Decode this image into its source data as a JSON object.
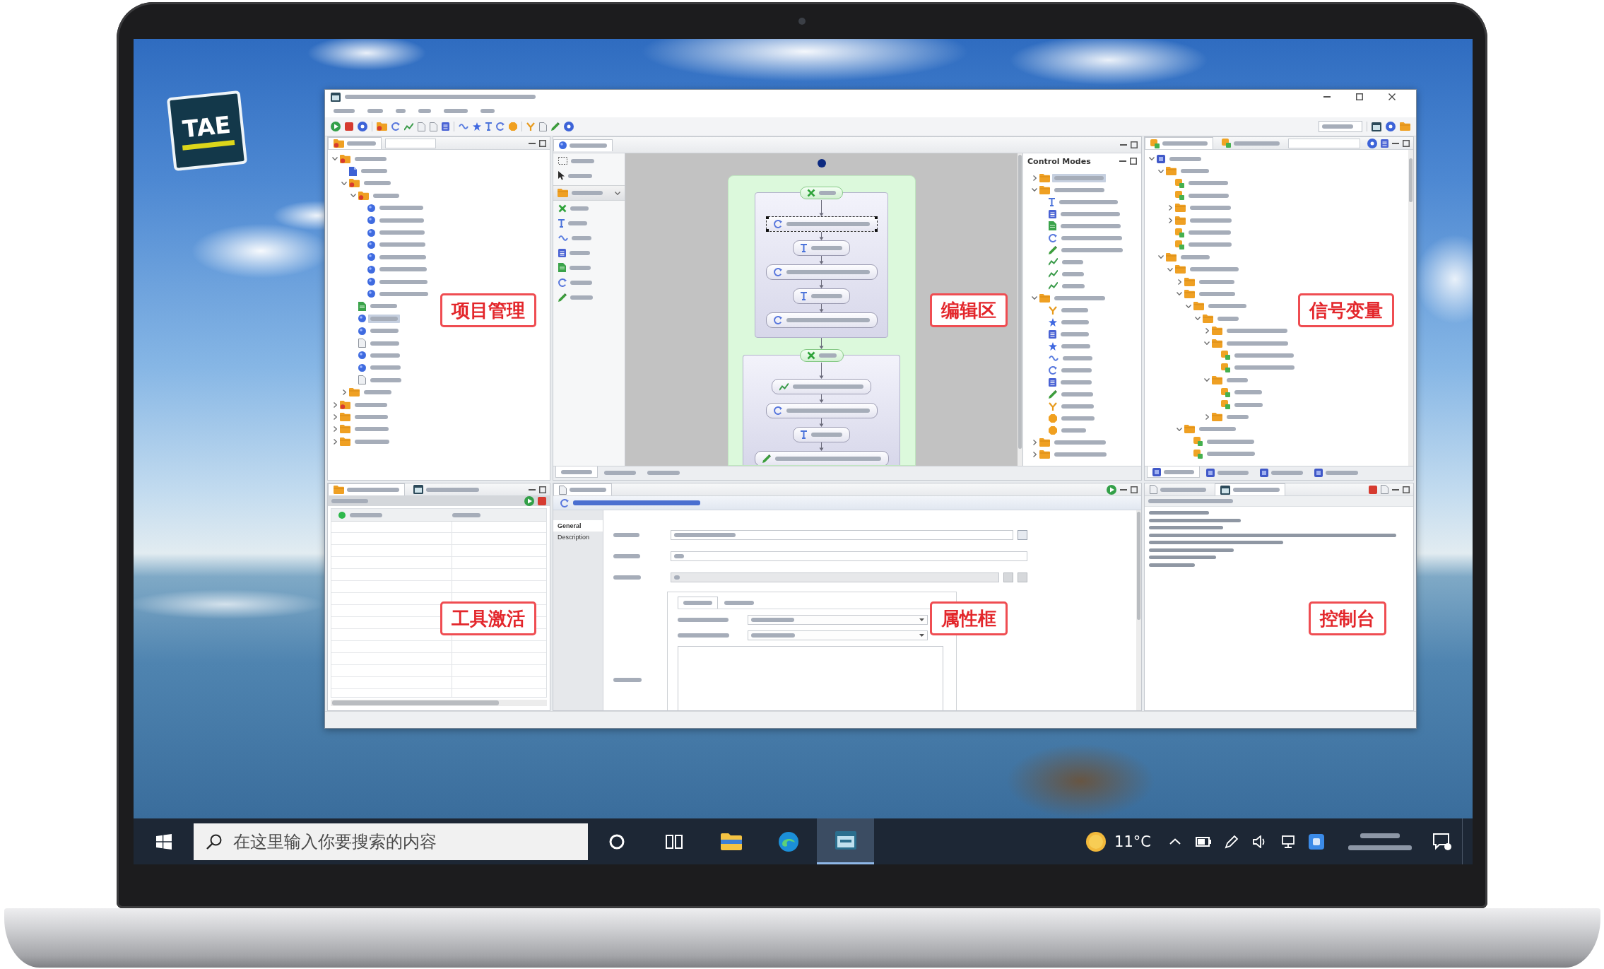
{
  "logo": {
    "text": "TAE"
  },
  "ide": {
    "project_panel": {
      "tabs": [
        {
          "selected": true
        }
      ],
      "tree": [
        {
          "kind": "project",
          "expanded": true,
          "selected": false,
          "children": [
            {
              "kind": "report",
              "selected": false
            },
            {
              "kind": "project",
              "expanded": true,
              "selected": false,
              "children": [
                {
                  "kind": "project",
                  "expanded": true,
                  "selected": false,
                  "children": [
                    {
                      "kind": "test",
                      "selected": false
                    },
                    {
                      "kind": "test",
                      "selected": false
                    },
                    {
                      "kind": "test",
                      "selected": false
                    },
                    {
                      "kind": "test",
                      "selected": false
                    },
                    {
                      "kind": "test",
                      "selected": false
                    },
                    {
                      "kind": "test",
                      "selected": false
                    },
                    {
                      "kind": "test",
                      "selected": false
                    },
                    {
                      "kind": "test",
                      "selected": false
                    }
                  ]
                },
                {
                  "kind": "script",
                  "selected": false
                },
                {
                  "kind": "test",
                  "selected": true
                },
                {
                  "kind": "test",
                  "selected": false
                },
                {
                  "kind": "doc",
                  "selected": false
                },
                {
                  "kind": "test",
                  "selected": false
                },
                {
                  "kind": "test",
                  "selected": false
                },
                {
                  "kind": "doc",
                  "selected": false
                }
              ]
            },
            {
              "kind": "folder",
              "expanded": false,
              "selected": false
            }
          ]
        },
        {
          "kind": "project",
          "expanded": false,
          "selected": false
        },
        {
          "kind": "folder",
          "expanded": false,
          "selected": false
        },
        {
          "kind": "folder",
          "expanded": false,
          "selected": false
        },
        {
          "kind": "folder",
          "expanded": false,
          "selected": false
        }
      ]
    },
    "editor": {
      "tabs": [
        {
          "selected": true
        }
      ],
      "palette": {
        "tools": [
          {
            "kind": "marquee"
          },
          {
            "kind": "select"
          }
        ],
        "drawer": {
          "expanded": true,
          "tools": [
            {
              "kind": "group"
            },
            {
              "kind": "wait"
            },
            {
              "kind": "loop"
            },
            {
              "kind": "block"
            },
            {
              "kind": "script"
            },
            {
              "kind": "read"
            },
            {
              "kind": "write"
            }
          ]
        }
      },
      "flow": {
        "groups": [
          {
            "nodes": [
              {
                "kind": "read",
                "selected": true
              },
              {
                "kind": "wait",
                "selected": false
              },
              {
                "kind": "read",
                "selected": false
              },
              {
                "kind": "wait",
                "selected": false
              },
              {
                "kind": "read",
                "selected": false
              }
            ]
          },
          {
            "nodes": [
              {
                "kind": "capture",
                "selected": false
              },
              {
                "kind": "read",
                "selected": false
              },
              {
                "kind": "wait",
                "selected": false
              },
              {
                "kind": "write",
                "selected": false
              }
            ]
          }
        ]
      },
      "bottom_tabs": [
        {
          "selected": true
        },
        {
          "selected": false
        },
        {
          "selected": false
        }
      ]
    },
    "control_modes": {
      "title": "Control Modes",
      "tree": [
        {
          "kind": "folder",
          "expanded": false,
          "selected": true
        },
        {
          "kind": "folder",
          "expanded": true,
          "selected": false,
          "children": [
            {
              "kind": "wait",
              "selected": false
            },
            {
              "kind": "block",
              "selected": false
            },
            {
              "kind": "script",
              "selected": false
            },
            {
              "kind": "read",
              "selected": false
            },
            {
              "kind": "write",
              "selected": false
            },
            {
              "kind": "capture",
              "selected": false
            },
            {
              "kind": "capture",
              "selected": false
            },
            {
              "kind": "capture",
              "selected": false
            }
          ]
        },
        {
          "kind": "folder",
          "expanded": true,
          "selected": false,
          "children": [
            {
              "kind": "branch",
              "selected": false
            },
            {
              "kind": "star",
              "selected": false
            },
            {
              "kind": "block",
              "selected": false
            },
            {
              "kind": "star",
              "selected": false
            },
            {
              "kind": "loop",
              "selected": false
            },
            {
              "kind": "read",
              "selected": false
            },
            {
              "kind": "block",
              "selected": false
            },
            {
              "kind": "write",
              "selected": false
            },
            {
              "kind": "branch",
              "selected": false
            },
            {
              "kind": "exit",
              "selected": false
            },
            {
              "kind": "exit",
              "selected": false
            }
          ]
        },
        {
          "kind": "folder",
          "expanded": false,
          "selected": false
        },
        {
          "kind": "folder",
          "expanded": false,
          "selected": false
        }
      ]
    },
    "signal_panel": {
      "tabs": [
        {
          "selected": true
        },
        {
          "selected": false
        }
      ],
      "tree": [
        {
          "kind": "root",
          "expanded": true,
          "selected": false,
          "children": [
            {
              "kind": "folder",
              "expanded": true,
              "selected": false,
              "children": [
                {
                  "kind": "signal",
                  "selected": false
                },
                {
                  "kind": "signal",
                  "selected": false
                },
                {
                  "kind": "folder",
                  "expanded": false,
                  "selected": false
                },
                {
                  "kind": "folder",
                  "expanded": false,
                  "selected": false
                },
                {
                  "kind": "signal",
                  "selected": false
                },
                {
                  "kind": "signal",
                  "selected": false
                }
              ]
            },
            {
              "kind": "folder",
              "expanded": true,
              "selected": false,
              "children": [
                {
                  "kind": "folder",
                  "expanded": true,
                  "selected": false,
                  "children": [
                    {
                      "kind": "folder",
                      "expanded": false,
                      "selected": false
                    },
                    {
                      "kind": "folder",
                      "expanded": true,
                      "selected": false,
                      "children": [
                        {
                          "kind": "folder",
                          "expanded": true,
                          "selected": false,
                          "children": [
                            {
                              "kind": "folder",
                              "expanded": true,
                              "selected": false,
                              "children": [
                                {
                                  "kind": "folder",
                                  "expanded": false,
                                  "selected": false
                                },
                                {
                                  "kind": "folder",
                                  "expanded": true,
                                  "selected": false,
                                  "children": [
                                    {
                                      "kind": "signal",
                                      "selected": false
                                    },
                                    {
                                      "kind": "signal",
                                      "selected": false
                                    }
                                  ]
                                },
                                {
                                  "kind": "folder",
                                  "expanded": true,
                                  "selected": false,
                                  "children": [
                                    {
                                      "kind": "signal",
                                      "selected": false
                                    },
                                    {
                                      "kind": "signal",
                                      "selected": false
                                    }
                                  ]
                                },
                                {
                                  "kind": "folder",
                                  "expanded": false,
                                  "selected": false
                                }
                              ]
                            }
                          ]
                        }
                      ]
                    },
                    {
                      "kind": "folder",
                      "expanded": true,
                      "selected": false,
                      "children": [
                        {
                          "kind": "signal",
                          "selected": false
                        },
                        {
                          "kind": "signal",
                          "selected": false
                        }
                      ]
                    }
                  ]
                }
              ]
            }
          ]
        }
      ],
      "bottom_tabs": [
        {
          "selected": true
        },
        {
          "selected": false
        },
        {
          "selected": false
        },
        {
          "selected": false
        }
      ]
    },
    "tool_panel": {
      "tabs": [
        {
          "selected": true
        },
        {
          "selected": false
        }
      ]
    },
    "properties": {
      "tabs": [
        {
          "selected": true
        }
      ],
      "side_tabs": [
        {
          "label": "General",
          "selected": true
        },
        {
          "label": "Description",
          "selected": false
        }
      ],
      "fields": [
        {
          "kind": "browse"
        },
        {
          "kind": "text"
        },
        {
          "kind": "disabled"
        }
      ],
      "group": {
        "tabs": [
          {
            "selected": true
          },
          {
            "selected": false
          }
        ],
        "fields": [
          {
            "kind": "combo"
          },
          {
            "kind": "combo"
          }
        ],
        "expression": {
          "kind": "textarea"
        }
      }
    },
    "console": {
      "tabs": [
        {
          "selected": false
        },
        {
          "selected": true
        }
      ]
    }
  },
  "annotations": [
    {
      "text": "项目管理"
    },
    {
      "text": "编辑区"
    },
    {
      "text": "信号变量"
    },
    {
      "text": "工具激活"
    },
    {
      "text": "属性框"
    },
    {
      "text": "控制台"
    }
  ],
  "taskbar": {
    "search": {
      "placeholder": "在这里输入你要搜索的内容"
    },
    "apps": [
      {
        "kind": "assistant",
        "selected": false
      },
      {
        "kind": "task_view",
        "selected": false
      },
      {
        "kind": "files",
        "selected": false
      },
      {
        "kind": "browser",
        "selected": false
      },
      {
        "kind": "app",
        "selected": true
      }
    ],
    "weather": {
      "temperature": "11°C"
    }
  }
}
